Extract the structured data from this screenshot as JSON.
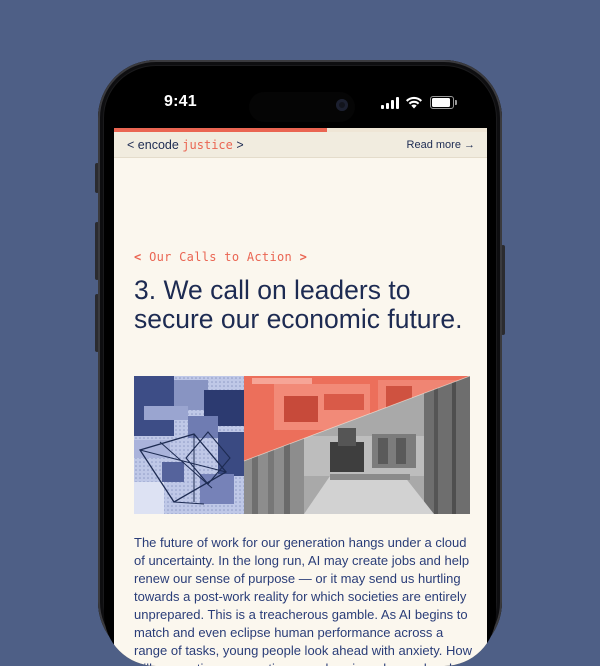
{
  "status_bar": {
    "time": "9:41",
    "icons": [
      "cellular-signal-icon",
      "wifi-icon",
      "battery-icon"
    ]
  },
  "page": {
    "progress_percent": 57,
    "brand": {
      "open": "<",
      "word1": "encode",
      "word2": "justice",
      "close": ">"
    },
    "read_more": "Read more →",
    "eyebrow": {
      "open": "<",
      "label": "Our Calls to Action",
      "close": ">"
    },
    "headline": "3. We call on leaders to secure our economic future.",
    "hero_image_alt": "warehouse robotics collage",
    "body": "The future of work for our generation hangs under a cloud of uncertainty. In the long run, AI may create jobs and help renew our sense of purpose — or it may send us hurtling towards a post-work reality for which societies are entirely unprepared. This is a treacherous gamble. As AI begins to match and even eclipse human performance across a range of tasks, young people look ahead with anxiety. How will we continue supporting ourselves in a changed and uncertain"
  },
  "colors": {
    "background": "#4e5f86",
    "page": "#fbf7ee",
    "accent": "#ea6552",
    "navy": "#1d2b52",
    "body_text": "#2a3d78"
  }
}
